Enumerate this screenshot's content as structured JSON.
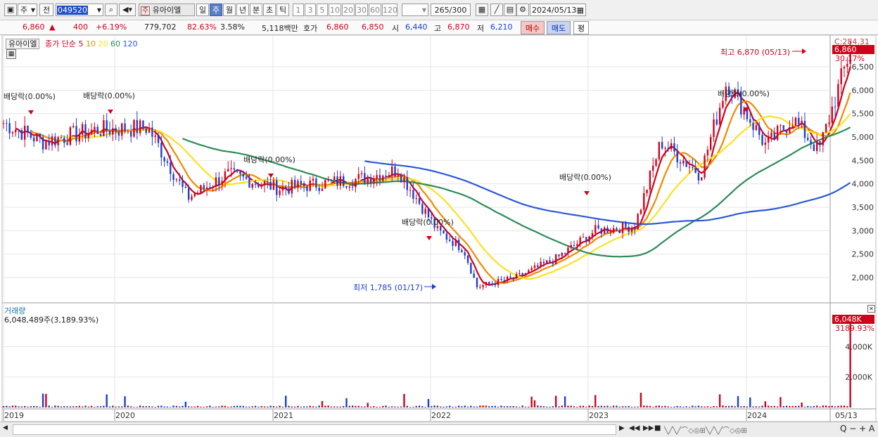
{
  "toolbar": {
    "market": "주",
    "period_mode": "전",
    "stock_code": "049520",
    "stock_badge": "주",
    "stock_name": "유아이엘",
    "period_buttons": [
      "일",
      "주",
      "월",
      "년",
      "분",
      "초",
      "틱"
    ],
    "selected_period": "주",
    "interval_buttons": [
      "1",
      "3",
      "5",
      "10",
      "20",
      "30",
      "60",
      "120"
    ],
    "count_display": "265",
    "count_total": "/300",
    "date": "2024/05/13"
  },
  "quote": {
    "price": "6,860",
    "change_arrow": "▲",
    "change": "400",
    "change_pct": "+6.19%",
    "volume": "779,702",
    "ratio": "82.63%",
    "turnover": "3.58%",
    "amount": "5,118백만",
    "hoga_label": "호가",
    "ask": "6,860",
    "bid": "6,850",
    "open_label": "시",
    "open": "6,440",
    "high_label": "고",
    "high": "6,870",
    "low_label": "저",
    "low": "6,210",
    "buy_label": "매수",
    "sell_label": "매도",
    "eval_label": "평"
  },
  "price_panel": {
    "stock_label": "유아이엘",
    "ma_title": "종가 단순",
    "ma_periods": [
      "5",
      "10",
      "20",
      "60",
      "120"
    ],
    "ma_colors": [
      "#d0021b",
      "#f08a00",
      "#ffe020",
      "#2e8b57",
      "#2b58d6"
    ],
    "c_label": "C:284.31",
    "last_price": "6,860",
    "last_pct": "30.17%",
    "high_annotation": "최고 6,870 (05/13)",
    "low_annotation": "최저 1,785 (01/17)",
    "dividend_label": "배당락(0.00%)",
    "y_ticks": [
      "6,500",
      "6,000",
      "5,500",
      "5,000",
      "4,500",
      "4,000",
      "3,500",
      "3,000",
      "2,500",
      "2,000"
    ]
  },
  "volume_panel": {
    "title": "거래량",
    "info": "6,048,489주(3,189.93%)",
    "last_volume": "6,048K",
    "last_pct": "3189.93%",
    "y_ticks": [
      "4,000K",
      "2,000K"
    ]
  },
  "x_axis": {
    "labels": [
      "2019",
      "2020",
      "2021",
      "2022",
      "2023",
      "2024"
    ],
    "last_date": "05/13"
  },
  "chart_data": {
    "type": "candlestick",
    "title": "유아이엘",
    "period": "weekly",
    "x_range": [
      "2019-01",
      "2024-05-13"
    ],
    "y_range": [
      1785,
      6870
    ],
    "ylim": [
      1600,
      7000
    ],
    "close_series_approx": [
      {
        "date": "2019-01",
        "close": 5300
      },
      {
        "date": "2019-04",
        "close": 4900
      },
      {
        "date": "2019-08",
        "close": 5150
      },
      {
        "date": "2019-12",
        "close": 5200
      },
      {
        "date": "2020-03",
        "close": 3700
      },
      {
        "date": "2020-06",
        "close": 4200
      },
      {
        "date": "2020-10",
        "close": 3900
      },
      {
        "date": "2021-01",
        "close": 4000
      },
      {
        "date": "2021-04",
        "close": 4100
      },
      {
        "date": "2021-07",
        "close": 4300
      },
      {
        "date": "2021-10",
        "close": 3000
      },
      {
        "date": "2021-12",
        "close": 2600
      },
      {
        "date": "2022-01",
        "close": 1800
      },
      {
        "date": "2022-04",
        "close": 2000
      },
      {
        "date": "2022-07",
        "close": 2400
      },
      {
        "date": "2022-10",
        "close": 3000
      },
      {
        "date": "2023-01",
        "close": 3100
      },
      {
        "date": "2023-03",
        "close": 4900
      },
      {
        "date": "2023-06",
        "close": 4200
      },
      {
        "date": "2023-08",
        "close": 6200
      },
      {
        "date": "2023-11",
        "close": 4800
      },
      {
        "date": "2024-01",
        "close": 5400
      },
      {
        "date": "2024-03",
        "close": 4700
      },
      {
        "date": "2024-05-13",
        "close": 6860
      }
    ],
    "annotations": [
      {
        "text": "최고 6,870 (05/13)",
        "value": 6870
      },
      {
        "text": "최저 1,785 (01/17)",
        "value": 1785
      }
    ],
    "volume": {
      "last": "6,048K",
      "ylim_labels": [
        "2,000K",
        "4,000K"
      ]
    }
  }
}
